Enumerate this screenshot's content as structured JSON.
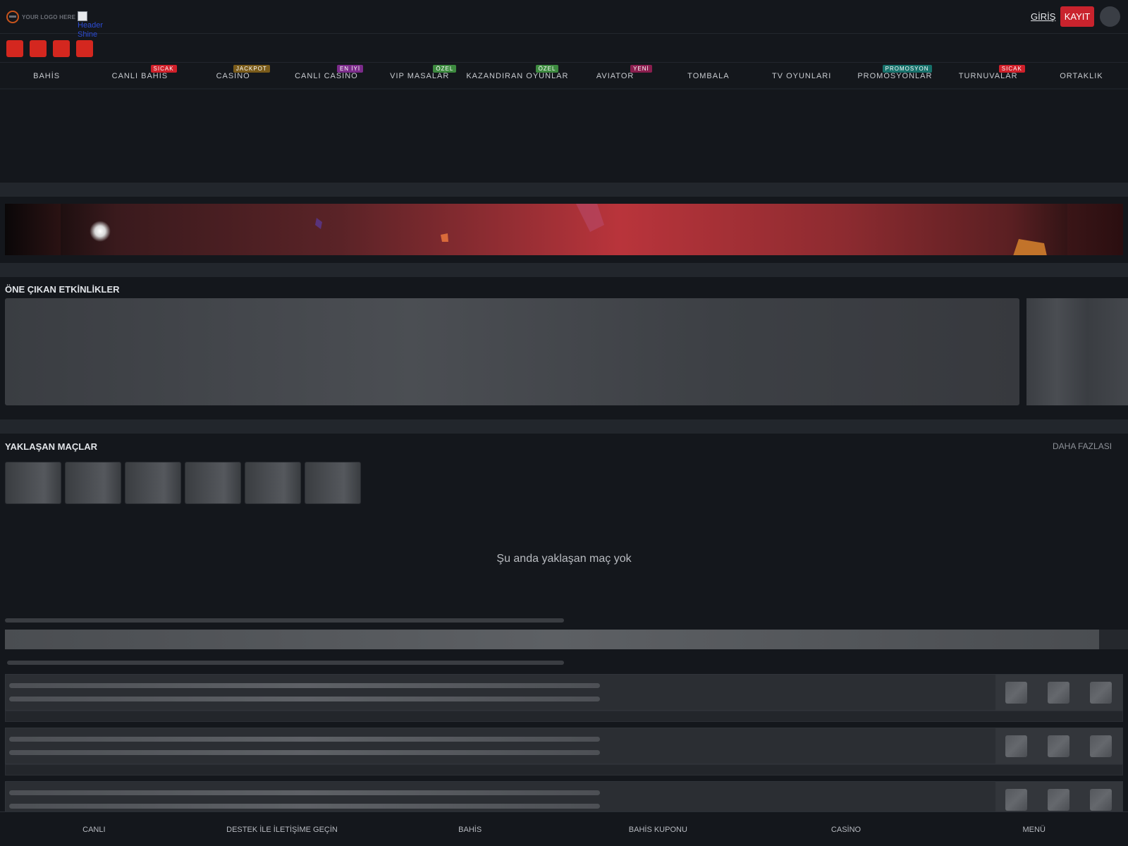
{
  "header": {
    "logo_text": "YOUR LOGO HERE",
    "broken_image_alt": "Header Shine",
    "login_label": "GİRİŞ",
    "register_label": "KAYIT",
    "colors": {
      "register_bg": "#c9232d",
      "social_bg": "#d4271f"
    }
  },
  "social": {
    "count": 4
  },
  "nav": {
    "items": [
      {
        "label": "BAHİS",
        "badge": ""
      },
      {
        "label": "CANLI BAHİS",
        "badge": "SICAK",
        "badge_color": "#d0202a"
      },
      {
        "label": "CASİNO",
        "badge": "JACKPOT",
        "badge_color": "#7a5b1a"
      },
      {
        "label": "CANLI CASİNO",
        "badge": "EN İYİ",
        "badge_color": "#7b2b8a"
      },
      {
        "label": "VIP MASALAR",
        "badge": "ÖZEL",
        "badge_color": "#3d8a3f"
      },
      {
        "label": "KAZANDIRAN OYUNLAR",
        "badge": "ÖZEL",
        "badge_color": "#3d8a3f"
      },
      {
        "label": "AVIATOR",
        "badge": "YENİ",
        "badge_color": "#8a1e4e"
      },
      {
        "label": "TOMBALA",
        "badge": ""
      },
      {
        "label": "TV OYUNLARI",
        "badge": ""
      },
      {
        "label": "PROMOSYONLAR",
        "badge": "PROMOSYON",
        "badge_color": "#16706a"
      },
      {
        "label": "TURNUVALAR",
        "badge": "SICAK",
        "badge_color": "#d0202a"
      },
      {
        "label": "ORTAKLIK",
        "badge": ""
      }
    ]
  },
  "featured": {
    "title": "ÖNE ÇIKAN ETKİNLİKLER"
  },
  "upcoming": {
    "title": "YAKLAŞAN MAÇLAR",
    "more_label": "DAHA FAZLASI",
    "empty_message": "Şu anda yaklaşan maç yok"
  },
  "bottom_nav": {
    "items": [
      "CANLI",
      "DESTEK İLE İLETİŞİME GEÇİN",
      "BAHİS",
      "BAHİS KUPONU",
      "CASİNO",
      "MENÜ"
    ]
  }
}
